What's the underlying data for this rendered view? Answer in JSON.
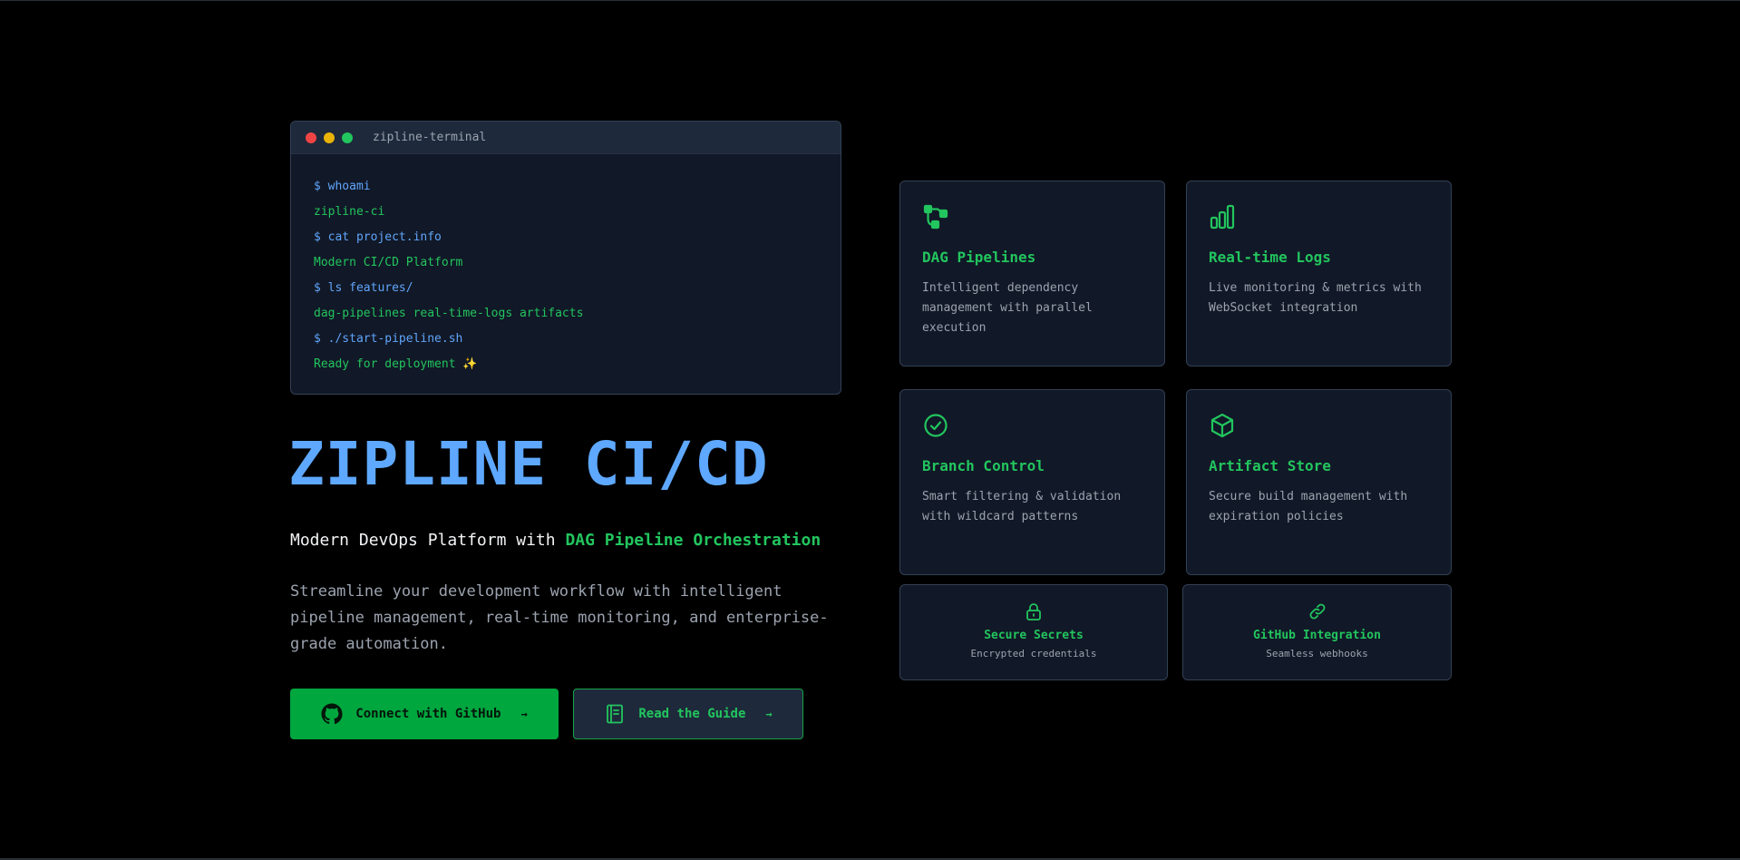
{
  "terminal": {
    "title": "zipline-terminal",
    "lines": [
      {
        "kind": "cmd",
        "text": "$ whoami"
      },
      {
        "kind": "out",
        "text": "zipline-ci"
      },
      {
        "kind": "cmd",
        "text": "$ cat project.info"
      },
      {
        "kind": "out",
        "text": "Modern CI/CD Platform"
      },
      {
        "kind": "cmd",
        "text": "$ ls features/"
      },
      {
        "kind": "out",
        "text": "dag-pipelines real-time-logs artifacts"
      },
      {
        "kind": "cmd",
        "text": "$ ./start-pipeline.sh"
      },
      {
        "kind": "out",
        "text": "Ready for deployment ✨"
      }
    ]
  },
  "hero": {
    "title": "ZIPLINE CI/CD",
    "subtitle_prefix": "Modern DevOps Platform with ",
    "subtitle_accent": "DAG Pipeline Orchestration",
    "description": "Streamline your development workflow with intelligent pipeline management, real-time monitoring, and enterprise-grade automation."
  },
  "buttons": {
    "github_label": "Connect with GitHub",
    "guide_label": "Read the Guide",
    "arrow": "→"
  },
  "features": [
    {
      "icon": "git-branch-icon",
      "title": "DAG Pipelines",
      "description": "Intelligent dependency management with parallel execution"
    },
    {
      "icon": "bar-chart-icon",
      "title": "Real-time Logs",
      "description": "Live monitoring & metrics with WebSocket integration"
    },
    {
      "icon": "check-circle-icon",
      "title": "Branch Control",
      "description": "Smart filtering & validation with wildcard patterns"
    },
    {
      "icon": "package-icon",
      "title": "Artifact Store",
      "description": "Secure build management with expiration policies"
    }
  ],
  "mini_features": [
    {
      "icon": "lock-icon",
      "title": "Secure Secrets",
      "description": "Encrypted credentials"
    },
    {
      "icon": "link-icon",
      "title": "GitHub Integration",
      "description": "Seamless webhooks"
    }
  ],
  "colors": {
    "background": "#000000",
    "accent_green": "#22c55e",
    "title_blue": "#5ea8ff",
    "card_bg": "#111827",
    "button_green": "#00a63e"
  }
}
